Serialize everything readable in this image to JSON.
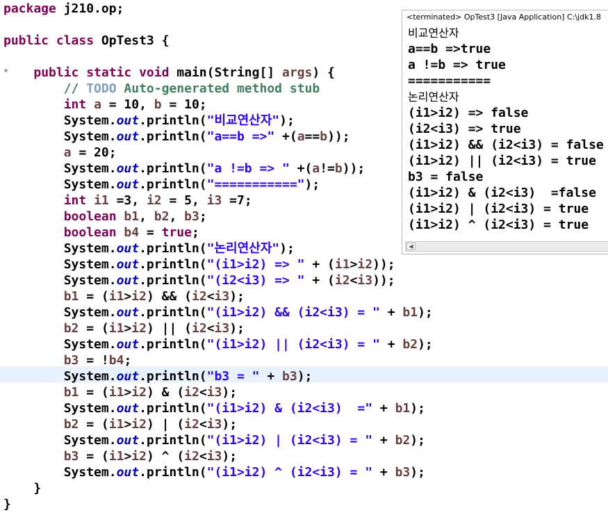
{
  "editor": {
    "lines": [
      {
        "parts": [
          {
            "c": "kw",
            "t": "package "
          },
          {
            "c": "",
            "t": "j210.op;"
          }
        ]
      },
      {
        "parts": []
      },
      {
        "parts": [
          {
            "c": "kw",
            "t": "public class "
          },
          {
            "c": "",
            "t": "OpTest3 {"
          }
        ]
      },
      {
        "parts": []
      },
      {
        "parts": [
          {
            "c": "",
            "t": "    "
          },
          {
            "c": "kw",
            "t": "public static void "
          },
          {
            "c": "",
            "t": "main(String[] "
          },
          {
            "c": "var",
            "t": "args"
          },
          {
            "c": "",
            "t": ") {"
          }
        ]
      },
      {
        "parts": [
          {
            "c": "",
            "t": "        "
          },
          {
            "c": "cm",
            "t": "// "
          },
          {
            "c": "todo",
            "t": "TODO"
          },
          {
            "c": "cm",
            "t": " Auto-generated method stub"
          }
        ]
      },
      {
        "parts": [
          {
            "c": "",
            "t": "        "
          },
          {
            "c": "kw",
            "t": "int "
          },
          {
            "c": "var",
            "t": "a"
          },
          {
            "c": "",
            "t": " = 10, "
          },
          {
            "c": "var",
            "t": "b"
          },
          {
            "c": "",
            "t": " = 10;"
          }
        ]
      },
      {
        "parts": [
          {
            "c": "",
            "t": "        System."
          },
          {
            "c": "fld",
            "t": "out"
          },
          {
            "c": "",
            "t": ".println("
          },
          {
            "c": "str",
            "t": "\"비교연산자\""
          },
          {
            "c": "",
            "t": ");"
          }
        ]
      },
      {
        "parts": [
          {
            "c": "",
            "t": "        System."
          },
          {
            "c": "fld",
            "t": "out"
          },
          {
            "c": "",
            "t": ".println("
          },
          {
            "c": "str",
            "t": "\"a==b =>\""
          },
          {
            "c": "",
            "t": " +("
          },
          {
            "c": "var",
            "t": "a"
          },
          {
            "c": "",
            "t": "=="
          },
          {
            "c": "var",
            "t": "b"
          },
          {
            "c": "",
            "t": "));"
          }
        ]
      },
      {
        "parts": [
          {
            "c": "",
            "t": "        "
          },
          {
            "c": "var",
            "t": "a"
          },
          {
            "c": "",
            "t": " = 20;"
          }
        ]
      },
      {
        "parts": [
          {
            "c": "",
            "t": "        System."
          },
          {
            "c": "fld",
            "t": "out"
          },
          {
            "c": "",
            "t": ".println("
          },
          {
            "c": "str",
            "t": "\"a !=b => \""
          },
          {
            "c": "",
            "t": " +("
          },
          {
            "c": "var",
            "t": "a"
          },
          {
            "c": "",
            "t": "!="
          },
          {
            "c": "var",
            "t": "b"
          },
          {
            "c": "",
            "t": "));"
          }
        ]
      },
      {
        "parts": [
          {
            "c": "",
            "t": "        System."
          },
          {
            "c": "fld",
            "t": "out"
          },
          {
            "c": "",
            "t": ".println("
          },
          {
            "c": "str",
            "t": "\"===========\""
          },
          {
            "c": "",
            "t": ");"
          }
        ]
      },
      {
        "parts": [
          {
            "c": "",
            "t": "        "
          },
          {
            "c": "kw",
            "t": "int "
          },
          {
            "c": "var",
            "t": "i1"
          },
          {
            "c": "",
            "t": " =3, "
          },
          {
            "c": "var",
            "t": "i2"
          },
          {
            "c": "",
            "t": " = 5, "
          },
          {
            "c": "var",
            "t": "i3"
          },
          {
            "c": "",
            "t": " =7;"
          }
        ]
      },
      {
        "parts": [
          {
            "c": "",
            "t": "        "
          },
          {
            "c": "kw",
            "t": "boolean "
          },
          {
            "c": "var",
            "t": "b1"
          },
          {
            "c": "",
            "t": ", "
          },
          {
            "c": "var",
            "t": "b2"
          },
          {
            "c": "",
            "t": ", "
          },
          {
            "c": "var",
            "t": "b3"
          },
          {
            "c": "",
            "t": ";"
          }
        ]
      },
      {
        "parts": [
          {
            "c": "",
            "t": "        "
          },
          {
            "c": "kw",
            "t": "boolean "
          },
          {
            "c": "var",
            "t": "b4"
          },
          {
            "c": "",
            "t": " = "
          },
          {
            "c": "kw",
            "t": "true"
          },
          {
            "c": "",
            "t": ";"
          }
        ]
      },
      {
        "parts": [
          {
            "c": "",
            "t": "        System."
          },
          {
            "c": "fld",
            "t": "out"
          },
          {
            "c": "",
            "t": ".println("
          },
          {
            "c": "str",
            "t": "\"논리연산자\""
          },
          {
            "c": "",
            "t": ");"
          }
        ]
      },
      {
        "parts": [
          {
            "c": "",
            "t": "        System."
          },
          {
            "c": "fld",
            "t": "out"
          },
          {
            "c": "",
            "t": ".println("
          },
          {
            "c": "str",
            "t": "\"(i1>i2) => \""
          },
          {
            "c": "",
            "t": " + ("
          },
          {
            "c": "var",
            "t": "i1"
          },
          {
            "c": "",
            "t": ">"
          },
          {
            "c": "var",
            "t": "i2"
          },
          {
            "c": "",
            "t": "));"
          }
        ]
      },
      {
        "parts": [
          {
            "c": "",
            "t": "        System."
          },
          {
            "c": "fld",
            "t": "out"
          },
          {
            "c": "",
            "t": ".println("
          },
          {
            "c": "str",
            "t": "\"(i2<i3) => \""
          },
          {
            "c": "",
            "t": " + ("
          },
          {
            "c": "var",
            "t": "i2"
          },
          {
            "c": "",
            "t": "<"
          },
          {
            "c": "var",
            "t": "i3"
          },
          {
            "c": "",
            "t": "));"
          }
        ]
      },
      {
        "parts": [
          {
            "c": "",
            "t": "        "
          },
          {
            "c": "var",
            "t": "b1"
          },
          {
            "c": "",
            "t": " = ("
          },
          {
            "c": "var",
            "t": "i1"
          },
          {
            "c": "",
            "t": ">"
          },
          {
            "c": "var",
            "t": "i2"
          },
          {
            "c": "",
            "t": ") && ("
          },
          {
            "c": "var",
            "t": "i2"
          },
          {
            "c": "",
            "t": "<"
          },
          {
            "c": "var",
            "t": "i3"
          },
          {
            "c": "",
            "t": ");"
          }
        ]
      },
      {
        "parts": [
          {
            "c": "",
            "t": "        System."
          },
          {
            "c": "fld",
            "t": "out"
          },
          {
            "c": "",
            "t": ".println("
          },
          {
            "c": "str",
            "t": "\"(i1>i2) && (i2<i3) = \""
          },
          {
            "c": "",
            "t": " + "
          },
          {
            "c": "var",
            "t": "b1"
          },
          {
            "c": "",
            "t": ");"
          }
        ]
      },
      {
        "parts": [
          {
            "c": "",
            "t": "        "
          },
          {
            "c": "var",
            "t": "b2"
          },
          {
            "c": "",
            "t": " = ("
          },
          {
            "c": "var",
            "t": "i1"
          },
          {
            "c": "",
            "t": ">"
          },
          {
            "c": "var",
            "t": "i2"
          },
          {
            "c": "",
            "t": ") || ("
          },
          {
            "c": "var",
            "t": "i2"
          },
          {
            "c": "",
            "t": "<"
          },
          {
            "c": "var",
            "t": "i3"
          },
          {
            "c": "",
            "t": ");"
          }
        ]
      },
      {
        "parts": [
          {
            "c": "",
            "t": "        System."
          },
          {
            "c": "fld",
            "t": "out"
          },
          {
            "c": "",
            "t": ".println("
          },
          {
            "c": "str",
            "t": "\"(i1>i2) || (i2<i3) = \""
          },
          {
            "c": "",
            "t": " + "
          },
          {
            "c": "var",
            "t": "b2"
          },
          {
            "c": "",
            "t": ");"
          }
        ]
      },
      {
        "parts": [
          {
            "c": "",
            "t": "        "
          },
          {
            "c": "var",
            "t": "b3"
          },
          {
            "c": "",
            "t": " = !"
          },
          {
            "c": "var",
            "t": "b4"
          },
          {
            "c": "",
            "t": ";"
          }
        ]
      },
      {
        "parts": [
          {
            "c": "",
            "t": "        System."
          },
          {
            "c": "fld",
            "t": "out"
          },
          {
            "c": "",
            "t": ".println("
          },
          {
            "c": "str",
            "t": "\"b3 = \""
          },
          {
            "c": "",
            "t": " + "
          },
          {
            "c": "var",
            "t": "b3"
          },
          {
            "c": "",
            "t": ");"
          }
        ]
      },
      {
        "parts": [
          {
            "c": "",
            "t": "        "
          },
          {
            "c": "var",
            "t": "b1"
          },
          {
            "c": "",
            "t": " = ("
          },
          {
            "c": "var",
            "t": "i1"
          },
          {
            "c": "",
            "t": ">"
          },
          {
            "c": "var",
            "t": "i2"
          },
          {
            "c": "",
            "t": ") & ("
          },
          {
            "c": "var",
            "t": "i2"
          },
          {
            "c": "",
            "t": "<"
          },
          {
            "c": "var",
            "t": "i3"
          },
          {
            "c": "",
            "t": ");"
          }
        ]
      },
      {
        "parts": [
          {
            "c": "",
            "t": "        System."
          },
          {
            "c": "fld",
            "t": "out"
          },
          {
            "c": "",
            "t": ".println("
          },
          {
            "c": "str",
            "t": "\"(i1>i2) & (i2<i3)  =\""
          },
          {
            "c": "",
            "t": " + "
          },
          {
            "c": "var",
            "t": "b1"
          },
          {
            "c": "",
            "t": ");"
          }
        ]
      },
      {
        "parts": [
          {
            "c": "",
            "t": "        "
          },
          {
            "c": "var",
            "t": "b2"
          },
          {
            "c": "",
            "t": " = ("
          },
          {
            "c": "var",
            "t": "i1"
          },
          {
            "c": "",
            "t": ">"
          },
          {
            "c": "var",
            "t": "i2"
          },
          {
            "c": "",
            "t": ") | ("
          },
          {
            "c": "var",
            "t": "i2"
          },
          {
            "c": "",
            "t": "<"
          },
          {
            "c": "var",
            "t": "i3"
          },
          {
            "c": "",
            "t": ");"
          }
        ]
      },
      {
        "parts": [
          {
            "c": "",
            "t": "        System."
          },
          {
            "c": "fld",
            "t": "out"
          },
          {
            "c": "",
            "t": ".println("
          },
          {
            "c": "str",
            "t": "\"(i1>i2) | (i2<i3) = \""
          },
          {
            "c": "",
            "t": " + "
          },
          {
            "c": "var",
            "t": "b2"
          },
          {
            "c": "",
            "t": ");"
          }
        ]
      },
      {
        "parts": [
          {
            "c": "",
            "t": "        "
          },
          {
            "c": "var",
            "t": "b3"
          },
          {
            "c": "",
            "t": " = ("
          },
          {
            "c": "var",
            "t": "i1"
          },
          {
            "c": "",
            "t": ">"
          },
          {
            "c": "var",
            "t": "i2"
          },
          {
            "c": "",
            "t": ") ^ ("
          },
          {
            "c": "var",
            "t": "i2"
          },
          {
            "c": "",
            "t": "<"
          },
          {
            "c": "var",
            "t": "i3"
          },
          {
            "c": "",
            "t": ");"
          }
        ]
      },
      {
        "parts": [
          {
            "c": "",
            "t": "        System."
          },
          {
            "c": "fld",
            "t": "out"
          },
          {
            "c": "",
            "t": ".println("
          },
          {
            "c": "str",
            "t": "\"(i1>i2) ^ (i2<i3) = \""
          },
          {
            "c": "",
            "t": " + "
          },
          {
            "c": "var",
            "t": "b3"
          },
          {
            "c": "",
            "t": ");"
          }
        ]
      },
      {
        "parts": [
          {
            "c": "",
            "t": "    }"
          }
        ]
      },
      {
        "parts": [
          {
            "c": "",
            "t": "}"
          }
        ]
      }
    ]
  },
  "console": {
    "title": "<terminated> OpTest3 [Java Application] C:\\jdk1.8",
    "lines": [
      "비교연산자",
      "a==b =>true",
      "a !=b => true",
      "===========",
      "논리연산자",
      "(i1>i2) => false",
      "(i2<i3) => true",
      "(i1>i2) && (i2<i3) = false",
      "(i1>i2) || (i2<i3) = true",
      "b3 = false",
      "(i1>i2) & (i2<i3)  =false",
      "(i1>i2) | (i2<i3) = true",
      "(i1>i2) ^ (i2<i3) = true"
    ]
  },
  "colors": {
    "keyword": "#7f0055",
    "string": "#2a00ff",
    "field": "#0000c0",
    "comment": "#3f7f5f",
    "todo": "#7f9fbf",
    "variable": "#6a3e3e",
    "current_line": "#e8f2fe"
  }
}
